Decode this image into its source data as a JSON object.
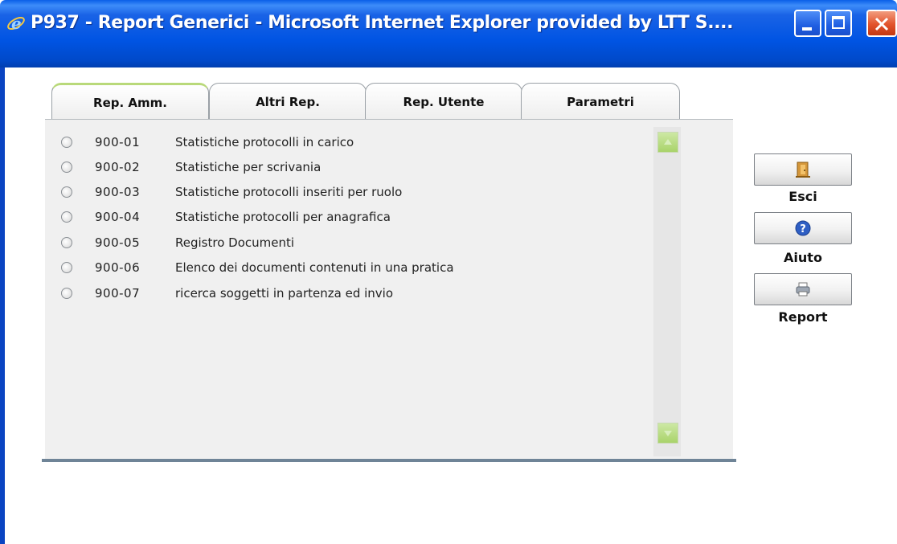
{
  "window": {
    "title": "P937 - Report Generici - Microsoft Internet Explorer provided by LTT S....",
    "titlebar_color": "#0054e3",
    "close_color": "#e2532b"
  },
  "tabs": [
    {
      "label": "Rep. Amm.",
      "active": true
    },
    {
      "label": "Altri Rep.",
      "active": false
    },
    {
      "label": "Rep. Utente",
      "active": false
    },
    {
      "label": "Parametri",
      "active": false
    }
  ],
  "reports": [
    {
      "code": "900-01",
      "label": "Statistiche protocolli in carico"
    },
    {
      "code": "900-02",
      "label": "Statistiche per scrivania"
    },
    {
      "code": "900-03",
      "label": "Statistiche protocolli inseriti per ruolo"
    },
    {
      "code": "900-04",
      "label": "Statistiche protocolli per anagrafica"
    },
    {
      "code": "900-05",
      "label": "Registro Documenti"
    },
    {
      "code": "900-06",
      "label": "Elenco dei documenti contenuti in una pratica"
    },
    {
      "code": "900-07",
      "label": "ricerca soggetti in partenza ed invio"
    }
  ],
  "actions": {
    "esci": {
      "label": "Esci",
      "icon": "door-exit-icon"
    },
    "aiuto": {
      "label": "Aiuto",
      "icon": "help-icon"
    },
    "report": {
      "label": "Report",
      "icon": "printer-icon"
    }
  },
  "scrollbar_color": "#a9d36a",
  "panel_border_color": "#6f8497"
}
